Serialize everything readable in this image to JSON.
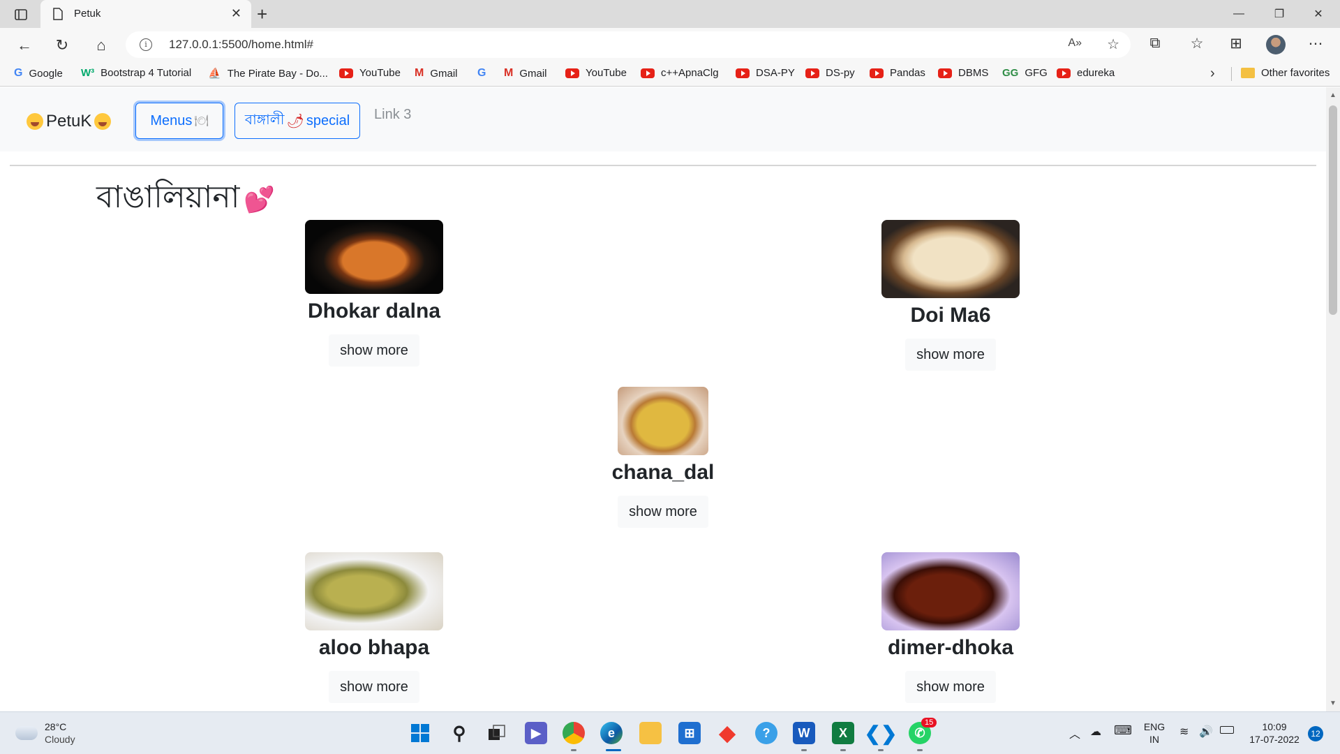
{
  "browser": {
    "tab_title": "Petuk",
    "url": "127.0.0.1:5500/home.html#",
    "bookmarks": [
      {
        "label": "Google",
        "icon": "google-icon"
      },
      {
        "label": "Bootstrap 4 Tutorial",
        "icon": "w3schools-icon"
      },
      {
        "label": "The Pirate Bay - Do...",
        "icon": "pirate-ship-icon"
      },
      {
        "label": "YouTube",
        "icon": "youtube-icon"
      },
      {
        "label": "Gmail",
        "icon": "gmail-icon"
      },
      {
        "label": "",
        "icon": "google-icon"
      },
      {
        "label": "Gmail",
        "icon": "gmail-icon"
      },
      {
        "label": "YouTube",
        "icon": "youtube-icon"
      },
      {
        "label": "c++ApnaClg",
        "icon": "youtube-icon"
      },
      {
        "label": "DSA-PY",
        "icon": "youtube-icon"
      },
      {
        "label": "DS-py",
        "icon": "youtube-icon"
      },
      {
        "label": "Pandas",
        "icon": "youtube-icon"
      },
      {
        "label": "DBMS",
        "icon": "youtube-icon"
      },
      {
        "label": "GFG",
        "icon": "gfg-icon"
      },
      {
        "label": "edureka",
        "icon": "youtube-icon"
      }
    ],
    "other_favorites": "Other favorites"
  },
  "site": {
    "brand": "PetuK",
    "menus_label": "Menus",
    "special_label": "বাঙ্গালী",
    "special_suffix": "special",
    "link3": "Link 3",
    "section_title": "বাঙালিয়ানা",
    "show_more": "show more",
    "dishes": [
      {
        "name": "Dhokar dalna"
      },
      {
        "name": "Doi Ma6"
      },
      {
        "name": "chana_dal"
      },
      {
        "name": "aloo bhapa"
      },
      {
        "name": "dimer-dhoka"
      }
    ]
  },
  "taskbar": {
    "temp": "28°C",
    "condition": "Cloudy",
    "lang_top": "ENG",
    "lang_bottom": "IN",
    "time": "10:09",
    "date": "17-07-2022",
    "notifications": "12",
    "whatsapp_badge": "15"
  }
}
